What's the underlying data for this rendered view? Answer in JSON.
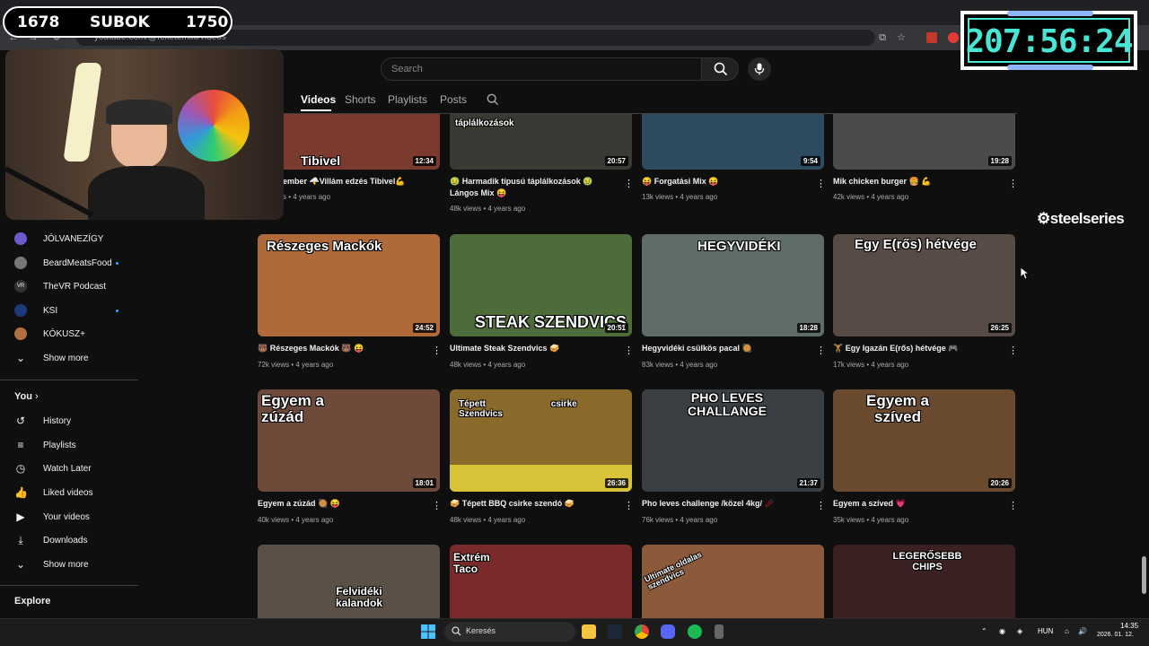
{
  "browser": {
    "url": "youtube.com/@feketemiki/videos"
  },
  "youtube": {
    "search_placeholder": "Search",
    "channel_tabs": [
      {
        "label": "Videos",
        "active": true
      },
      {
        "label": "Shorts"
      },
      {
        "label": "Playlists"
      },
      {
        "label": "Posts"
      }
    ]
  },
  "sidebar": {
    "subscriptions": [
      {
        "label": "JÓLVANEZÍGY",
        "color": "#6a5acd"
      },
      {
        "label": "BeardMeatsFood",
        "color": "#777",
        "dot": true
      },
      {
        "label": "TheVR Podcast",
        "color": "#333"
      },
      {
        "label": "KSI",
        "color": "#1c3a7a",
        "dot": true
      },
      {
        "label": "KÓKUSZ+",
        "color": "#b07040"
      }
    ],
    "show_more_1": "Show more",
    "you_heading": "You",
    "you_items": [
      {
        "label": "History",
        "icon": "history-icon"
      },
      {
        "label": "Playlists",
        "icon": "playlists-icon"
      },
      {
        "label": "Watch Later",
        "icon": "watch-later-icon"
      },
      {
        "label": "Liked videos",
        "icon": "like-icon"
      },
      {
        "label": "Your videos",
        "icon": "your-videos-icon"
      },
      {
        "label": "Downloads",
        "icon": "download-icon"
      }
    ],
    "show_more_2": "Show more",
    "explore_heading": "Explore"
  },
  "videos": [
    {
      "title": "ember 🌩️Villám edzés Tibivel💪",
      "meta": "s • 4 years ago",
      "duration": "12:34",
      "overlay": "Tibivel",
      "bg": "#7a3b2e"
    },
    {
      "title": "🤢 Harmadik típusú táplálkozások 🤢 Lángos Mix 😝",
      "meta": "48k views • 4 years ago",
      "duration": "20:57",
      "overlay": "táplálkozások",
      "bg": "#3a3a34"
    },
    {
      "title": "😝 Forgatási Mix 😝",
      "meta": "13k views • 4 years ago",
      "duration": "9:54",
      "overlay": "",
      "bg": "#2d4a5e"
    },
    {
      "title": "Mik chicken burger 🍔 💪",
      "meta": "42k views • 4 years ago",
      "duration": "19:28",
      "overlay": "",
      "bg": "#4b4b4b"
    },
    {
      "title": "🐻 Részeges Mackók 🐻 😝",
      "meta": "72k views • 4 years ago",
      "duration": "24:52",
      "overlay": "Részeges Mackók",
      "bg": "#b06a3a"
    },
    {
      "title": "Ultimate Steak Szendvics 🥪",
      "meta": "48k views • 4 years ago",
      "duration": "20:51",
      "overlay": "Steak szendvics",
      "bg": "#4e6b3a"
    },
    {
      "title": "Hegyvidéki csülkös pacal 🥘",
      "meta": "83k views • 4 years ago",
      "duration": "18:28",
      "overlay": "HEGYVIDÉKI",
      "bg": "#5f6d6a"
    },
    {
      "title": "🏋️ Egy Igazán E(rős) hétvége 🎮",
      "meta": "17k views • 4 years ago",
      "duration": "26:25",
      "overlay": "Egy E(rős) hétvége",
      "bg": "#584a44"
    },
    {
      "title": "Egyem a zúzád 🥘 😝",
      "meta": "40k views • 4 years ago",
      "duration": "18:01",
      "overlay": "Egyem a zúzád",
      "bg": "#6e4a3a"
    },
    {
      "title": "🥪 Tépett BBQ csirke szendó 🥪",
      "meta": "48k views • 4 years ago",
      "duration": "26:36",
      "overlay": "Tépett csirke Szendvics",
      "bg": "#8a6a2a"
    },
    {
      "title": "Pho leves challenge /közel 4kg/ 🥢",
      "meta": "76k views • 4 years ago",
      "duration": "21:37",
      "overlay": "PHO LEVES CHALLANGE",
      "bg": "#3a3f44"
    },
    {
      "title": "Egyem a szíved 💗",
      "meta": "35k views • 4 years ago",
      "duration": "20:26",
      "overlay": "Egyem a szíved",
      "bg": "#6a4a2e"
    },
    {
      "title": "",
      "meta": "",
      "duration": "",
      "overlay": "Felvidéki kalandok",
      "bg": "#5a5046"
    },
    {
      "title": "",
      "meta": "",
      "duration": "",
      "overlay": "Extrém Taco",
      "bg": "#7a2a2a"
    },
    {
      "title": "",
      "meta": "",
      "duration": "",
      "overlay": "Ultimate oldalas szendvics",
      "bg": "#8a5a3a"
    },
    {
      "title": "",
      "meta": "",
      "duration": "",
      "overlay": "LEGERŐSEBB CHIPS",
      "bg": "#3a2020"
    }
  ],
  "overlays": {
    "sub_left": "1678",
    "sub_label": "SUBOK",
    "sub_right": "1750",
    "timer": "207:56:24",
    "sponsor": "steelseries"
  },
  "taskbar": {
    "search_label": "Keresés",
    "lang": "HUN",
    "time": "14:35",
    "date": "2026. 01. 12."
  }
}
